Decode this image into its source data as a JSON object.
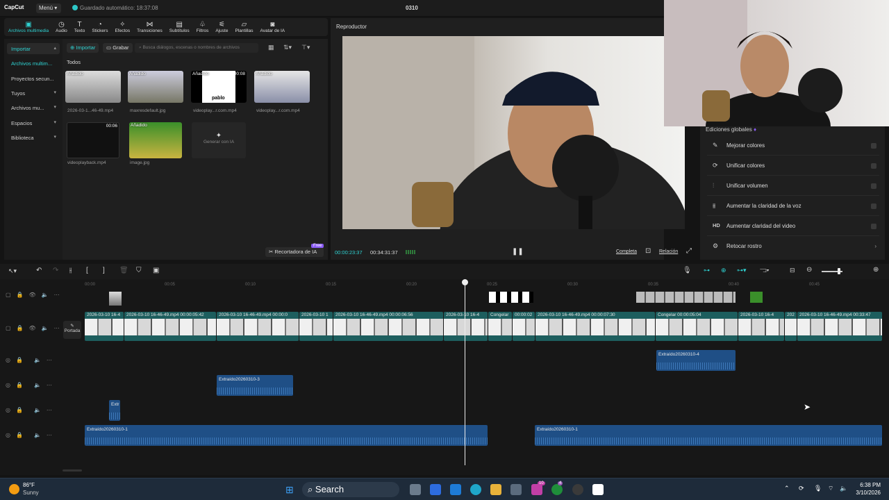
{
  "app": {
    "logo": "CapCut",
    "menu_label": "Menú",
    "autosave": "Guardado automático: 18:37:08",
    "project_title": "0310"
  },
  "toolbar": [
    {
      "label": "Archivos multimedia",
      "icon": "media-icon"
    },
    {
      "label": "Audio",
      "icon": "audio-icon"
    },
    {
      "label": "Texto",
      "icon": "text-icon"
    },
    {
      "label": "Stickers",
      "icon": "sticker-icon"
    },
    {
      "label": "Efectos",
      "icon": "effects-icon"
    },
    {
      "label": "Transiciones",
      "icon": "transitions-icon"
    },
    {
      "label": "Subtítulos",
      "icon": "subtitles-icon"
    },
    {
      "label": "Filtros",
      "icon": "filters-icon"
    },
    {
      "label": "Ajuste",
      "icon": "adjust-icon"
    },
    {
      "label": "Plantillas",
      "icon": "templates-icon"
    },
    {
      "label": "Avatar de IA",
      "icon": "avatar-icon"
    }
  ],
  "sidebar": [
    {
      "label": "Importar"
    },
    {
      "label": "Archivos multim..."
    },
    {
      "label": "Proyectos secun..."
    },
    {
      "label": "Tuyos"
    },
    {
      "label": "Archivos mu..."
    },
    {
      "label": "Espacios"
    },
    {
      "label": "Biblioteca"
    }
  ],
  "media": {
    "import_label": "Importar",
    "record_label": "Grabar",
    "search_placeholder": "Busca diálogos, escenas o nombres de archivos",
    "section": "Todos",
    "items": [
      {
        "name": "2026-03-1...46-49.mp4",
        "badge": "Añadido",
        "duration": ""
      },
      {
        "name": "maxresdefault.jpg",
        "badge": "Añadido",
        "duration": ""
      },
      {
        "name": "videoplay...r.com.mp4",
        "badge": "Añadido",
        "duration": "00:08"
      },
      {
        "name": "videoplay...r.com.mp4",
        "badge": "Añadido",
        "duration": ""
      },
      {
        "name": "videoplayback.mp4",
        "badge": "",
        "duration": "00:06"
      },
      {
        "name": "image.jpg",
        "badge": "Añadido",
        "duration": ""
      }
    ],
    "generate_label": "Generar con IA",
    "thumb3_text": "pablo",
    "ai_cutout_label": "Recortadora de IA",
    "free_badge": "Free"
  },
  "player": {
    "title": "Reproductor",
    "current_time": "00:00:23:37",
    "total_time": "00:34:31:37",
    "full_label": "Completa",
    "ratio_label": "Relación"
  },
  "global_edits": {
    "title": "Ediciones globales",
    "options": [
      {
        "label": "Mejorar colores",
        "icon": "color-enhance-icon"
      },
      {
        "label": "Unificar colores",
        "icon": "color-unify-icon"
      },
      {
        "label": "Unificar volumen",
        "icon": "volume-unify-icon"
      },
      {
        "label": "Aumentar la claridad de la voz",
        "icon": "voice-clarity-icon"
      },
      {
        "label": "Aumentar claridad del video",
        "icon": "hd-icon",
        "glyph": "HD"
      },
      {
        "label": "Retocar rostro",
        "icon": "face-retouch-icon"
      }
    ]
  },
  "timeline": {
    "ruler": [
      "00:00",
      "00:05",
      "00:10",
      "00:15",
      "00:20",
      "00:25",
      "00:30",
      "00:35",
      "00:40",
      "00:45"
    ],
    "cover_label": "Portada",
    "main_clips": [
      {
        "label": "2026-03-10 16-4"
      },
      {
        "label": "2026-03-10 16-46-49.mp4  00:00:05:42"
      },
      {
        "label": "2026-03-10 16-46-49.mp4  00:00:0"
      },
      {
        "label": "2026-03-10 1"
      },
      {
        "label": "2026-03-10 16-46-49.mp4  00:00:06:56"
      },
      {
        "label": "2026-03-10 16-4"
      },
      {
        "label": "Congelar"
      },
      {
        "label": "00:00:02"
      },
      {
        "label": "2026-03-10 16-46-49.mp4  00:00:07:30"
      },
      {
        "label": "Congelar  00:00:05:04"
      },
      {
        "label": "2026-03-10 16-4"
      },
      {
        "label": "202"
      },
      {
        "label": "2026-03-10 16-46-49.mp4  00:33:47"
      }
    ],
    "audio_clips": [
      {
        "label": "Extraído20260310-4"
      },
      {
        "label": "Extraído20260310-3"
      },
      {
        "label": "Extr"
      },
      {
        "label": "Extraído20260310-1"
      },
      {
        "label": "Extraído20260310-1"
      }
    ]
  },
  "taskbar": {
    "temp": "86°F",
    "weather": "Sunny",
    "search": "Search",
    "time": "6:38 PM",
    "date": "3/10/2026",
    "badge1": "10",
    "badge2": "4"
  }
}
